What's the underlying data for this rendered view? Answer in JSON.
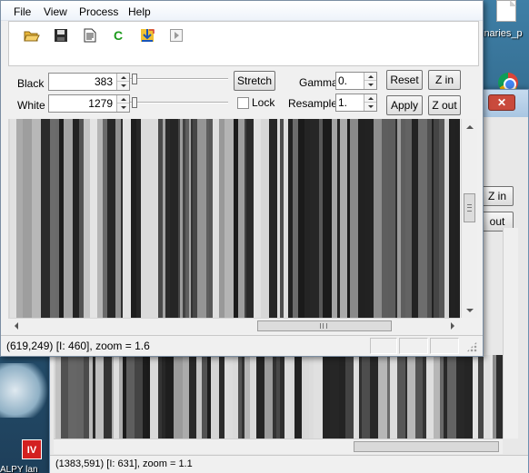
{
  "desktop": {
    "right_label": "inaries_p",
    "left_label": "ALPY lan",
    "iv_icon_text": "IV"
  },
  "background_window": {
    "zoom_in_label": "Z in",
    "zoom_out_label": "out",
    "status": "(1383,591) [I: 631], zoom = 1.1"
  },
  "menu": {
    "file": "File",
    "view": "View",
    "process": "Process",
    "help": "Help"
  },
  "toolbar": {
    "items": [
      "open-folder-icon",
      "save-disk-icon",
      "document-icon",
      "c-refresh-icon",
      "arrows-icon",
      "play-icon"
    ]
  },
  "controls": {
    "black_label": "Black",
    "black_value": "383",
    "white_label": "White",
    "white_value": "1279",
    "stretch_label": "Stretch",
    "lock_label": "Lock",
    "lock_checked": false,
    "gamma_label": "Gamma",
    "gamma_value": "0.",
    "resample_label": "Resample",
    "resample_value": "1.",
    "reset_label": "Reset",
    "apply_label": "Apply",
    "zoom_in_label": "Z in",
    "zoom_out_label": "Z out"
  },
  "status": {
    "text": "(619,249) [I: 460], zoom = 1.6"
  }
}
